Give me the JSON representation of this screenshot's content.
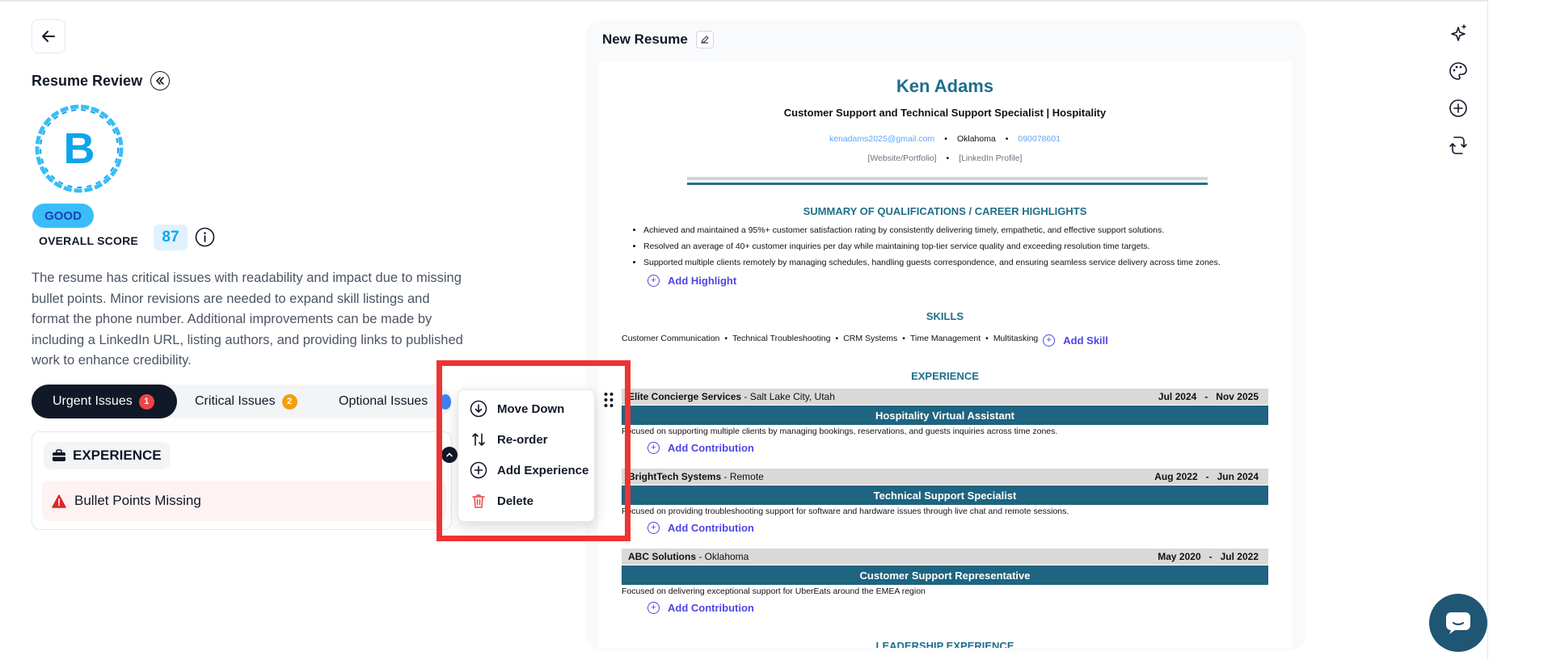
{
  "header": {
    "title": "Resume Review"
  },
  "score": {
    "grade": "B",
    "rating": "GOOD",
    "overall_label": "OVERALL SCORE",
    "value": "87"
  },
  "summary_text": "The resume has critical issues with readability and impact due to missing bullet points. Minor revisions are needed to expand skill listings and format the phone number. Additional improvements can be made by including a LinkedIn URL, listing authors, and providing links to published work to enhance credibility.",
  "tabs": [
    {
      "label": "Urgent Issues",
      "count": "1",
      "color": "#ef4444"
    },
    {
      "label": "Critical Issues",
      "count": "2",
      "color": "#f59e0b"
    },
    {
      "label": "Optional Issues",
      "count": "",
      "color": "#3b82f6"
    }
  ],
  "issues": {
    "section_label": "EXPERIENCE",
    "items": [
      {
        "label": "Bullet Points Missing"
      }
    ]
  },
  "context_menu": {
    "items": [
      {
        "label": "Move Down",
        "icon": "arrow-down-circle-icon"
      },
      {
        "label": "Re-order",
        "icon": "reorder-arrows-icon"
      },
      {
        "label": "Add Experience",
        "icon": "plus-circle-icon"
      },
      {
        "label": "Delete",
        "icon": "trash-icon"
      }
    ]
  },
  "preview": {
    "title": "New Resume"
  },
  "resume": {
    "name": "Ken Adams",
    "job_title": "Customer Support and Technical Support Specialist | Hospitality",
    "email": "kenadams2025@gmail.com",
    "location": "Oklahoma",
    "phone": "090078601",
    "website": "[Website/Portfolio]",
    "linkedin": "[LinkedIn Profile]",
    "summary_heading": "SUMMARY OF QUALIFICATIONS / CAREER HIGHLIGHTS",
    "highlights": [
      "Achieved and maintained a 95%+ customer satisfaction rating by consistently delivering timely, empathetic, and effective support solutions.",
      "Resolved an average of 40+ customer inquiries per day while maintaining top-tier service quality and exceeding resolution time targets.",
      "Supported multiple clients remotely by managing schedules, handling guests correspondence, and ensuring seamless service delivery across time zones."
    ],
    "add_highlight": "Add Highlight",
    "skills_heading": "SKILLS",
    "skills": [
      "Customer Communication",
      "Technical Troubleshooting",
      "CRM Systems",
      "Time Management",
      "Multitasking"
    ],
    "add_skill": "Add Skill",
    "experience_heading": "EXPERIENCE",
    "experience": [
      {
        "company": "Elite Concierge Services",
        "location": " - Salt Lake City, Utah",
        "start": "Jul 2024",
        "end": "Nov 2025",
        "role": "Hospitality Virtual Assistant",
        "desc": "Focused on supporting multiple clients by managing bookings, reservations, and guests inquiries across time zones."
      },
      {
        "company": "BrightTech Systems",
        "location": " - Remote",
        "start": "Aug 2022",
        "end": "Jun 2024",
        "role": "Technical Support Specialist",
        "desc": "Focused on providing troubleshooting support for software and hardware issues through live chat and remote sessions."
      },
      {
        "company": "ABC Solutions",
        "location": " - Oklahoma",
        "start": "May 2020",
        "end": "Jul 2022",
        "role": "Customer Support Representative",
        "desc": "Focused on delivering exceptional support for UberEats around the EMEA region"
      }
    ],
    "add_contribution": "Add Contribution",
    "date_sep": "-",
    "bullet_sep": "•",
    "leadership_heading": "LEADERSHIP EXPERIENCE"
  },
  "colors": {
    "accent": "#1f6f8b",
    "highlight": "#ef3333",
    "badge": "#38bdf8"
  }
}
